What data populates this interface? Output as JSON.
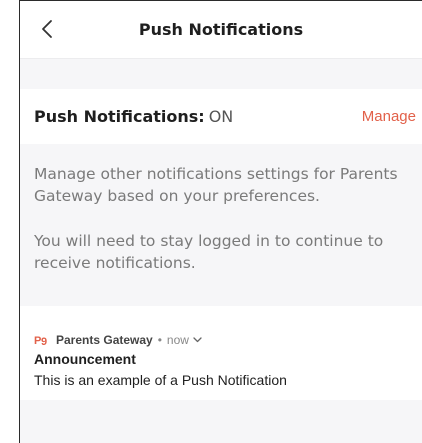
{
  "header": {
    "title": "Push Notifications",
    "back_icon": "chevron-left-icon"
  },
  "status": {
    "label": "Push Notifications:",
    "value": "ON",
    "manage_label": "Manage"
  },
  "description": {
    "line1": "Manage other notifications settings for Parents Gateway based on your preferences.",
    "line2": "You will need to stay logged in to continue to receive notifications."
  },
  "notification_preview": {
    "app_icon": "parents-gateway-logo",
    "app_name": "Parents Gateway",
    "separator": "•",
    "time": "now",
    "title": "Announcement",
    "body": "This is an example of a Push Notification"
  },
  "colors": {
    "accent": "#e2614a",
    "background": "#f6f6f8",
    "card": "#ffffff"
  }
}
